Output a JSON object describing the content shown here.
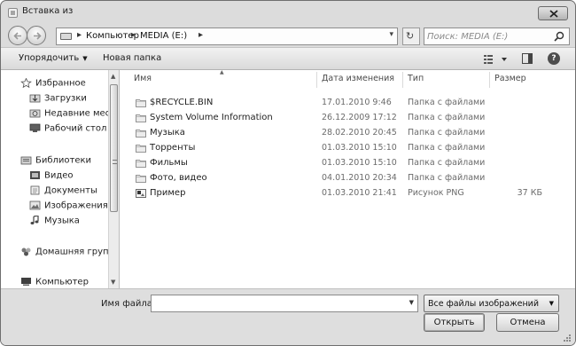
{
  "window": {
    "title": "Вставка из"
  },
  "address": {
    "crumbs": [
      "Компьютер",
      "MEDIA (E:)"
    ]
  },
  "search": {
    "placeholder": "Поиск: MEDIA (E:)"
  },
  "toolbar": {
    "organize_label": "Упорядочить",
    "new_folder_label": "Новая папка"
  },
  "sidebar": {
    "favorites": {
      "label": "Избранное",
      "items": [
        "Загрузки",
        "Недавние места",
        "Рабочий стол"
      ]
    },
    "libraries": {
      "label": "Библиотеки",
      "items": [
        "Видео",
        "Документы",
        "Изображения",
        "Музыка"
      ]
    },
    "homegroup": {
      "label": "Домашняя группа"
    },
    "computer": {
      "label": "Компьютер"
    }
  },
  "columns": {
    "name": "Имя",
    "date": "Дата изменения",
    "type": "Тип",
    "size": "Размер"
  },
  "files": [
    {
      "name": "$RECYCLE.BIN",
      "date": "17.01.2010 9:46",
      "type": "Папка с файлами",
      "size": "",
      "icon": "folder-icon"
    },
    {
      "name": "System Volume Information",
      "date": "26.12.2009 17:12",
      "type": "Папка с файлами",
      "size": "",
      "icon": "folder-icon"
    },
    {
      "name": "Музыка",
      "date": "28.02.2010 20:45",
      "type": "Папка с файлами",
      "size": "",
      "icon": "folder-icon"
    },
    {
      "name": "Торренты",
      "date": "01.03.2010 15:10",
      "type": "Папка с файлами",
      "size": "",
      "icon": "folder-icon"
    },
    {
      "name": "Фильмы",
      "date": "01.03.2010 15:10",
      "type": "Папка с файлами",
      "size": "",
      "icon": "folder-icon"
    },
    {
      "name": "Фото, видео",
      "date": "04.01.2010 20:34",
      "type": "Папка с файлами",
      "size": "",
      "icon": "folder-icon"
    },
    {
      "name": "Пример",
      "date": "01.03.2010 21:41",
      "type": "Рисунок PNG",
      "size": "37 КБ",
      "icon": "png-image-icon"
    }
  ],
  "bottom": {
    "filename_label": "Имя файла:",
    "filename_value": "",
    "filter_value": "Все файлы изображений",
    "open_label": "Открыть",
    "cancel_label": "Отмена"
  }
}
